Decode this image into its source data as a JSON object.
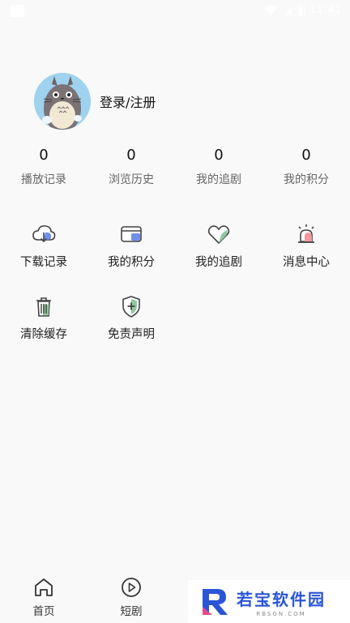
{
  "status_bar": {
    "time": "11:41"
  },
  "profile": {
    "login_label": "登录/注册"
  },
  "stats": [
    {
      "value": "0",
      "label": "播放记录"
    },
    {
      "value": "0",
      "label": "浏览历史"
    },
    {
      "value": "0",
      "label": "我的追剧"
    },
    {
      "value": "0",
      "label": "我的积分"
    }
  ],
  "menu": [
    {
      "label": "下载记录",
      "icon": "cloud-download-icon"
    },
    {
      "label": "我的积分",
      "icon": "card-icon"
    },
    {
      "label": "我的追剧",
      "icon": "heart-icon"
    },
    {
      "label": "消息中心",
      "icon": "alarm-light-icon"
    },
    {
      "label": "清除缓存",
      "icon": "trash-icon"
    },
    {
      "label": "免责声明",
      "icon": "shield-plus-icon"
    }
  ],
  "tabbar": [
    {
      "label": "首页",
      "icon": "home-icon"
    },
    {
      "label": "短剧",
      "icon": "play-circle-icon"
    }
  ],
  "watermark": {
    "text": "若宝软件园",
    "sub": "RBSGN.COM"
  },
  "colors": {
    "background": "#f9f9f9",
    "avatar_bg": "#9fd2ee",
    "accent_blue": "#6f8fe8"
  }
}
